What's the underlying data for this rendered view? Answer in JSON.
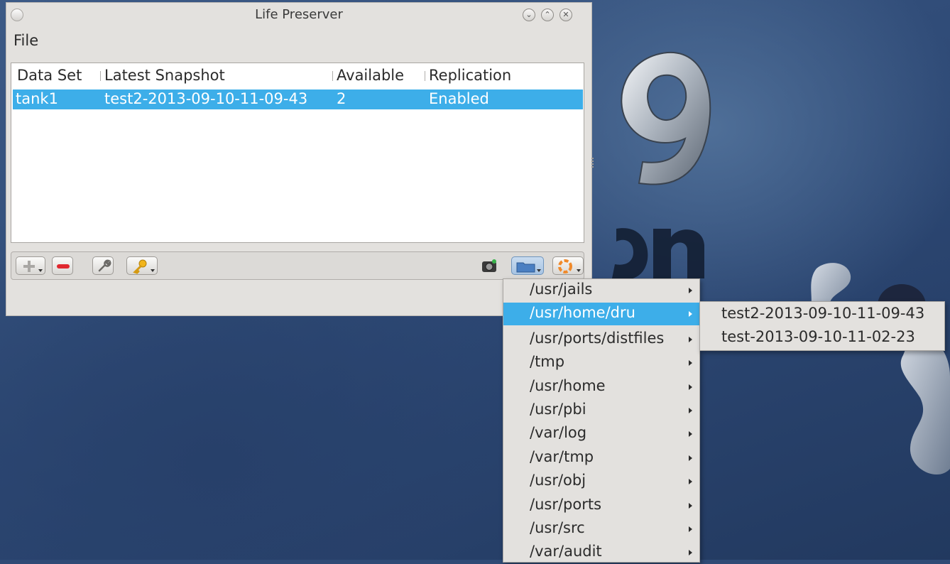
{
  "window": {
    "title": "Life Preserver",
    "controls": {
      "minimize": "⌄",
      "maximize": "⌃",
      "close": "✕"
    }
  },
  "menubar": {
    "file": "File"
  },
  "table": {
    "columns": [
      "Data Set",
      "Latest Snapshot",
      "Available",
      "Replication"
    ],
    "rows": [
      {
        "data_set": "tank1",
        "latest_snapshot": "test2-2013-09-10-11-09-43",
        "available": "2",
        "replication": "Enabled"
      }
    ]
  },
  "toolbar": {
    "left_buttons": [
      "add-icon",
      "remove-icon",
      "configure-wrench-icon",
      "key-icon"
    ],
    "right_buttons": [
      "camera-snapshot-icon",
      "folder-browse-icon",
      "lifebuoy-restore-icon"
    ]
  },
  "dataset_menu": {
    "items": [
      "/usr/jails",
      "/usr/home/dru",
      "/usr/ports/distfiles",
      "/tmp",
      "/usr/home",
      "/usr/pbi",
      "/var/log",
      "/var/tmp",
      "/usr/obj",
      "/usr/ports",
      "/usr/src",
      "/var/audit"
    ],
    "active_index": 1
  },
  "snapshot_submenu": {
    "items": [
      "test2-2013-09-10-11-09-43",
      "test-2013-09-10-11-02-23"
    ]
  },
  "colors": {
    "selection": "#3daee9",
    "window_bg": "#e3e1de",
    "desktop": "#2f4a75"
  }
}
